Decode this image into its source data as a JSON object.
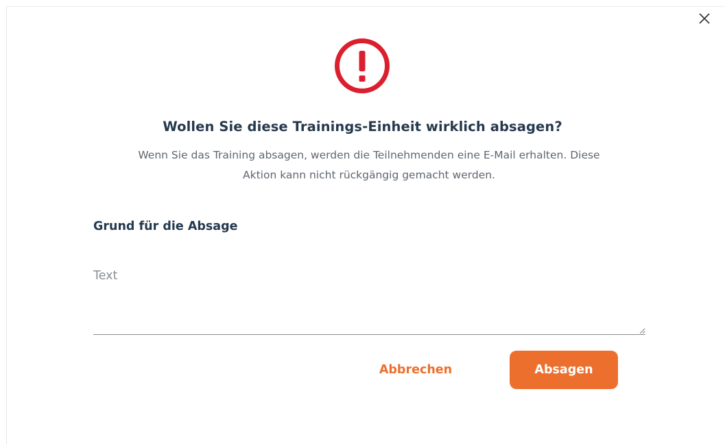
{
  "dialog": {
    "title": "Wollen Sie diese Trainings-Einheit wirklich absagen?",
    "description": "Wenn Sie das Training absagen, werden die Teilnehmenden eine E-Mail erhalten. Diese Aktion kann nicht rückgängig gemacht werden.",
    "icon": "warning-icon",
    "close_icon": "close-icon"
  },
  "reason_field": {
    "label": "Grund für die Absage",
    "placeholder": "Text",
    "value": ""
  },
  "actions": {
    "cancel_label": "Abbrechen",
    "confirm_label": "Absagen"
  },
  "colors": {
    "accent": "#ec6f2d",
    "warning": "#dc1f2e",
    "heading": "#25394e",
    "text": "#5e6670"
  }
}
